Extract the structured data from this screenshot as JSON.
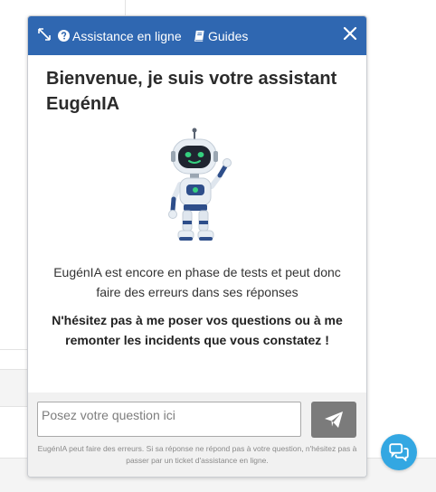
{
  "header": {
    "help_label": "Assistance en ligne",
    "guides_label": "Guides",
    "icons": [
      "resize-icon",
      "question-circle-icon",
      "book-icon",
      "close-icon"
    ]
  },
  "content": {
    "title": "Bienvenue, je suis votre assistant EugénIA",
    "intro": "EugénIA est encore en phase de tests et peut donc faire des erreurs dans ses réponses",
    "invite": "N'hésitez pas à me poser vos questions ou à me remonter les incidents que vous constatez !"
  },
  "composer": {
    "placeholder": "Posez votre question ici",
    "value": "",
    "send_icon": "send-icon",
    "disclaimer": "EugénIA peut faire des erreurs. Si sa réponse ne répond pas à votre question, n'hésitez pas à passer par un ticket d'assistance en ligne."
  },
  "floating": {
    "icon": "chat-bubbles-icon"
  },
  "colors": {
    "header_bg": "#2f67b1",
    "send_button": "#7b7b7b",
    "fab": "#33a7e2"
  }
}
